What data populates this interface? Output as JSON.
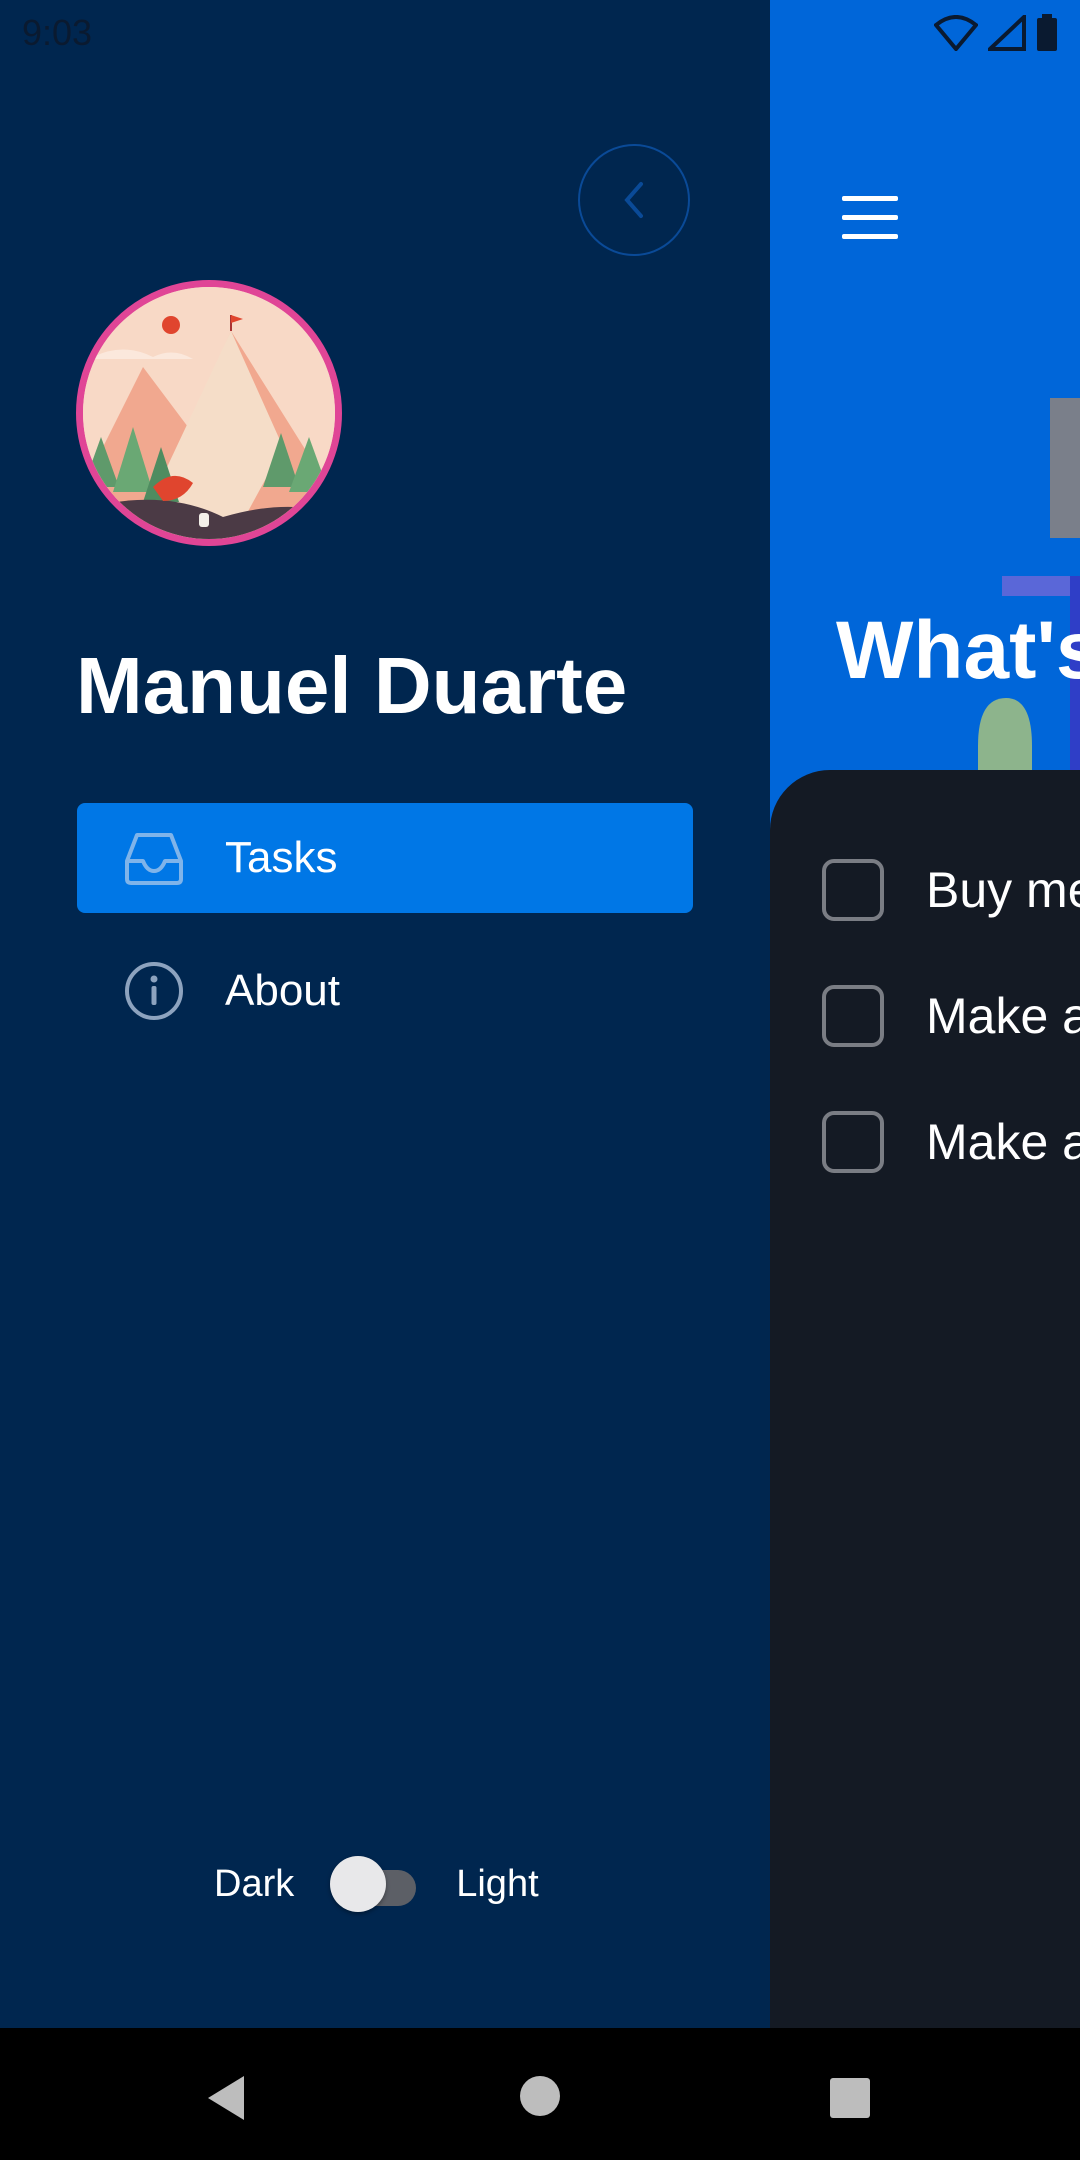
{
  "status_bar": {
    "time": "9:03",
    "icons": [
      "wifi-icon",
      "signal-icon",
      "battery-icon"
    ]
  },
  "drawer": {
    "user_name": "Manuel Duarte",
    "nav": [
      {
        "label": "Tasks",
        "icon": "inbox-tray-icon",
        "active": true
      },
      {
        "label": "About",
        "icon": "info-icon",
        "active": false
      }
    ],
    "theme_toggle": {
      "left_label": "Dark",
      "right_label": "Light",
      "selected": "Dark"
    }
  },
  "main": {
    "hero_title": "What's",
    "tasks": [
      {
        "label": "Buy me"
      },
      {
        "label": "Make a"
      },
      {
        "label": "Make a"
      }
    ]
  },
  "colors": {
    "drawer_bg": "#00264f",
    "accent": "#0077e6",
    "main_bg": "#0066d9",
    "sheet_bg": "#141a24",
    "avatar_border": "#e04596"
  }
}
